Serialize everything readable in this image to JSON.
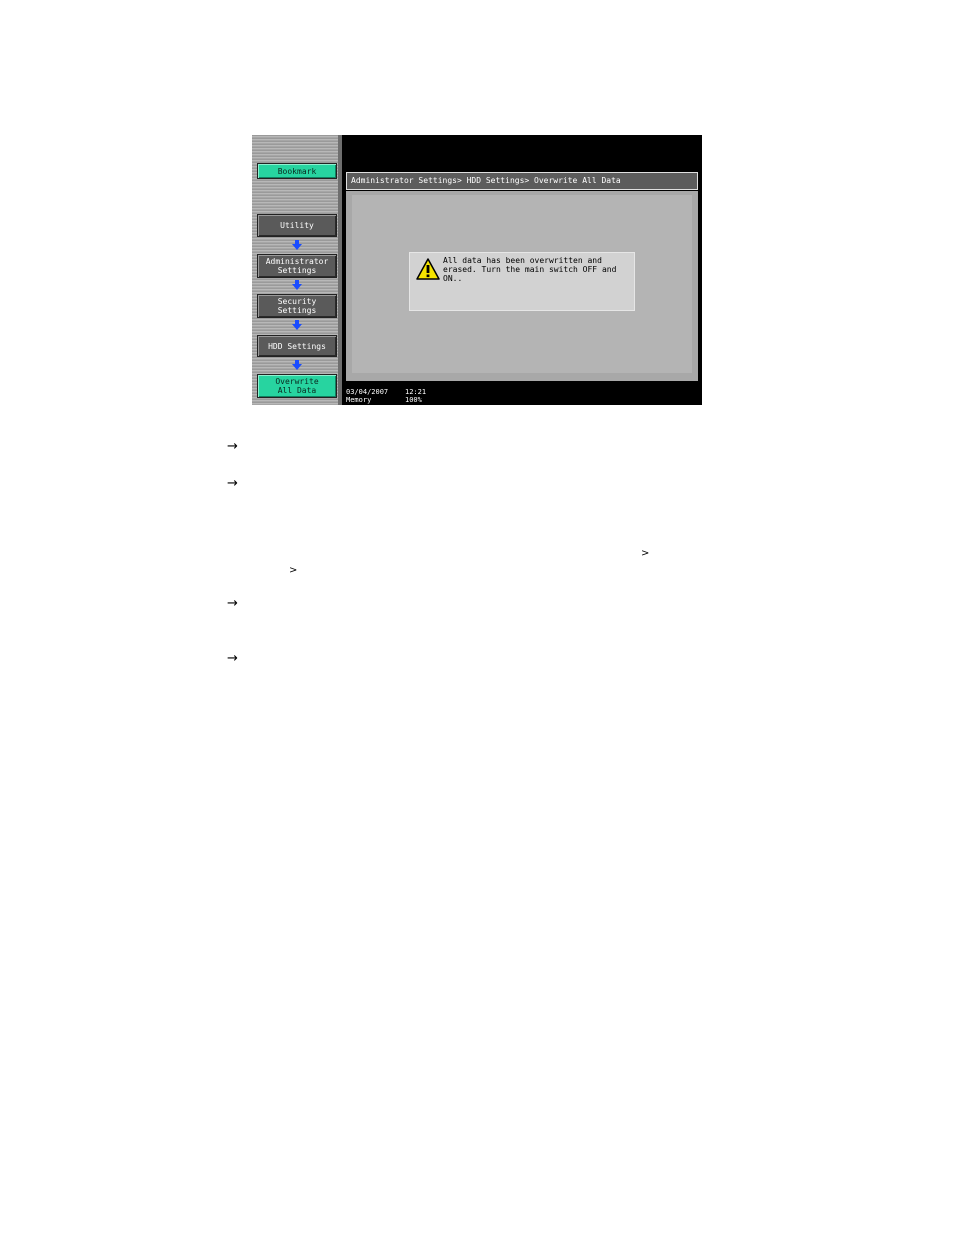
{
  "panel": {
    "sidebar": {
      "bookmark_label": "Bookmark",
      "items": [
        {
          "label": "Utility",
          "style": "gray"
        },
        {
          "label": "Administrator\nSettings",
          "style": "gray"
        },
        {
          "label": "Security\nSettings",
          "style": "gray"
        },
        {
          "label": "HDD Settings",
          "style": "gray"
        },
        {
          "label": "Overwrite\nAll Data",
          "style": "green"
        }
      ]
    },
    "breadcrumb": "Administrator Settings> HDD Settings> Overwrite All Data",
    "message": "All data has been overwritten and\nerased. Turn the main switch OFF and ON..",
    "status": {
      "date": "03/04/2007",
      "time": "12:21",
      "memory_label": "Memory",
      "memory_value": "100%"
    },
    "colors": {
      "accent_green": "#27d4a0",
      "button_gray": "#5a5a5a",
      "arrow_blue": "#1a4cff",
      "warning_yellow": "#f5e400"
    }
  },
  "document": {
    "step_arrows": [
      "→",
      "→",
      "→",
      "→"
    ],
    "inline_markers": [
      ">",
      ">"
    ]
  }
}
